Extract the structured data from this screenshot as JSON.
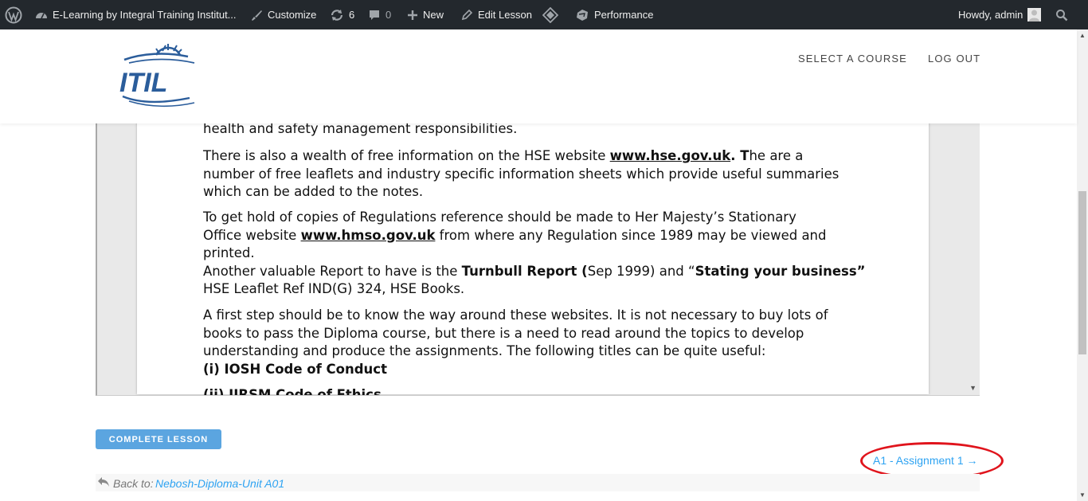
{
  "admin_bar": {
    "site_name": "E-Learning by Integral Training Institut...",
    "customize": "Customize",
    "updates_count": "6",
    "comments_count": "0",
    "new": "New",
    "edit_lesson": "Edit Lesson",
    "performance": "Performance",
    "greeting": "Howdy, admin"
  },
  "header": {
    "logo_text": "ITIL",
    "nav": [
      "SELECT A COURSE",
      "LOG OUT"
    ]
  },
  "document": {
    "line0": "health and safety management responsibilities.",
    "p1_a": "There is also a wealth of free information on the HSE website ",
    "p1_link": "www.hse.gov.uk",
    "p1_b": ".  ",
    "p1_T": "T",
    "p1_c": "he are a",
    "p1_line2": "number of free leaflets and industry specific information sheets which provide useful summaries",
    "p1_line3": "which can be added to the notes.",
    "p2_line1": "To get hold of copies of Regulations reference should be made to Her Majesty’s Stationary",
    "p2_a": "Office website ",
    "p2_link": "www.hmso.gov.uk",
    "p2_b": " from where any Regulation since 1989 may be viewed and",
    "p2_line3": "printed.",
    "p3_a": "Another valuable Report to have is the ",
    "p3_bold1": "Turnbull Report (",
    "p3_b": "Sep 1999) and “",
    "p3_bold2": "Stating your business”",
    "p3_line2": "HSE Leaflet Ref IND(G) 324, HSE Books.",
    "p4_line1": "A first step should be to know the way around these websites.  It is not necessary to buy lots of",
    "p4_line2": "books to pass the Diploma course, but there is a need to read around the topics to develop",
    "p4_line3": "understanding and produce the assignments.  The following titles can be quite useful:",
    "item_i": "(i)  IOSH Code of Conduct",
    "item_ii": "(ii) IIRSM Code of Ethics"
  },
  "complete_button": "COMPLETE LESSON",
  "next_lesson": "A1 - Assignment 1 →",
  "back": {
    "label": "Back to:",
    "link": "Nebosh-Diploma-Unit A01"
  },
  "colors": {
    "admin_bar_bg": "#23282d",
    "accent": "#2ea3f2",
    "button": "#5ba5e0",
    "annotation_oval": "#e0141c",
    "logo_blue": "#2b5d9b"
  }
}
